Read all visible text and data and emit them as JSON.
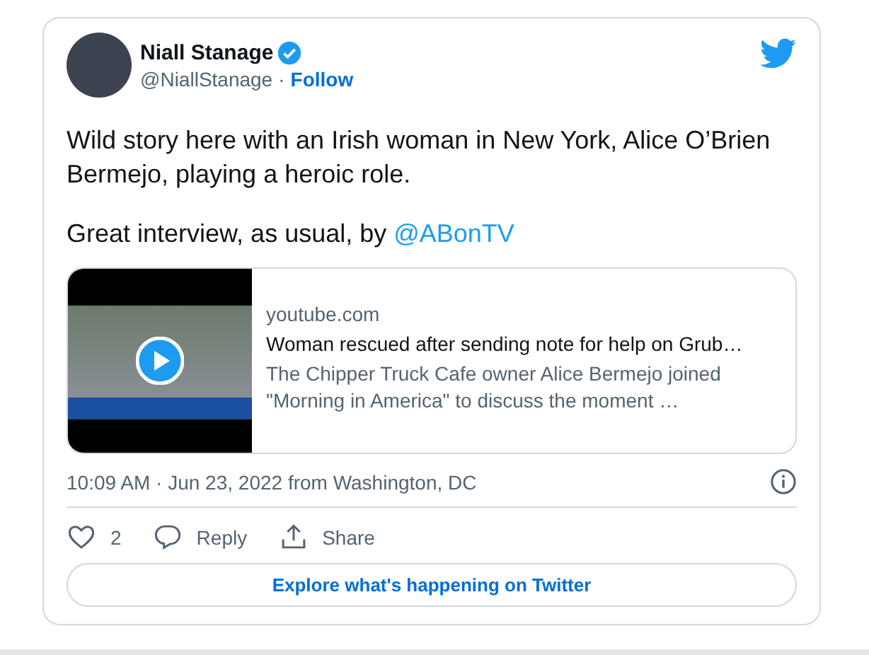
{
  "author": {
    "name": "Niall Stanage",
    "verified": true,
    "handle": "@NiallStanage",
    "separator": "·",
    "follow": "Follow"
  },
  "text": {
    "paragraphs": [
      "Wild story here with an Irish woman in New York, Alice O’Brien Bermejo, playing a heroic role."
    ],
    "lead": "Great interview, as usual, by ",
    "mention": "@ABonTV"
  },
  "link_card": {
    "domain": "youtube.com",
    "title": "Woman rescued after sending note for help on Grub…",
    "description": "The Chipper Truck Cafe owner Alice Bermejo joined \"Morning in America\" to discuss the moment …"
  },
  "timestamp": "10:09 AM · Jun 23, 2022 from Washington, DC",
  "actions": [
    {
      "kind": "like",
      "label": "2"
    },
    {
      "kind": "reply",
      "label": "Reply"
    },
    {
      "kind": "share",
      "label": "Share"
    }
  ],
  "explore_button": "Explore what's happening on Twitter"
}
